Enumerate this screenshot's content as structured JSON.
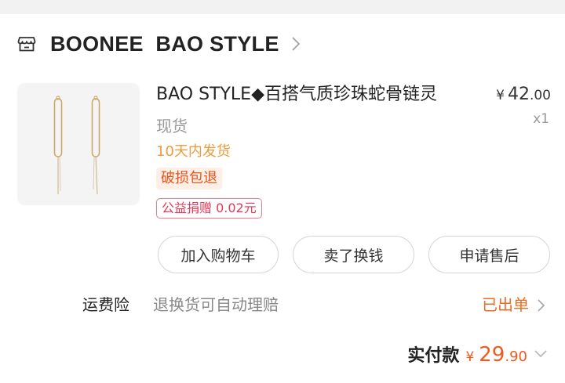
{
  "shop": {
    "name": "BOONEE  BAO STYLE",
    "icon": "store-icon"
  },
  "product": {
    "title": "BAO STYLE◆百搭气质珍珠蛇骨链灵",
    "price_currency": "¥",
    "price_integer": "42",
    "price_decimal": ".00",
    "quantity": "x1",
    "spec": "现货",
    "delivery": "10天内发货",
    "return_tag": "破损包退",
    "charity_tag": "公益捐赠 0.02元"
  },
  "actions": {
    "add_to_cart": "加入购物车",
    "resell": "卖了换钱",
    "after_sale": "申请售后"
  },
  "insurance": {
    "label": "运费险",
    "description": "退换货可自动理赔",
    "status": "已出单"
  },
  "total": {
    "label": "实付款",
    "currency": "¥",
    "integer": "29",
    "decimal": ".90"
  },
  "colors": {
    "accent": "#ee5a1f",
    "delivery": "#f29a3c",
    "charity": "#e23a58"
  }
}
